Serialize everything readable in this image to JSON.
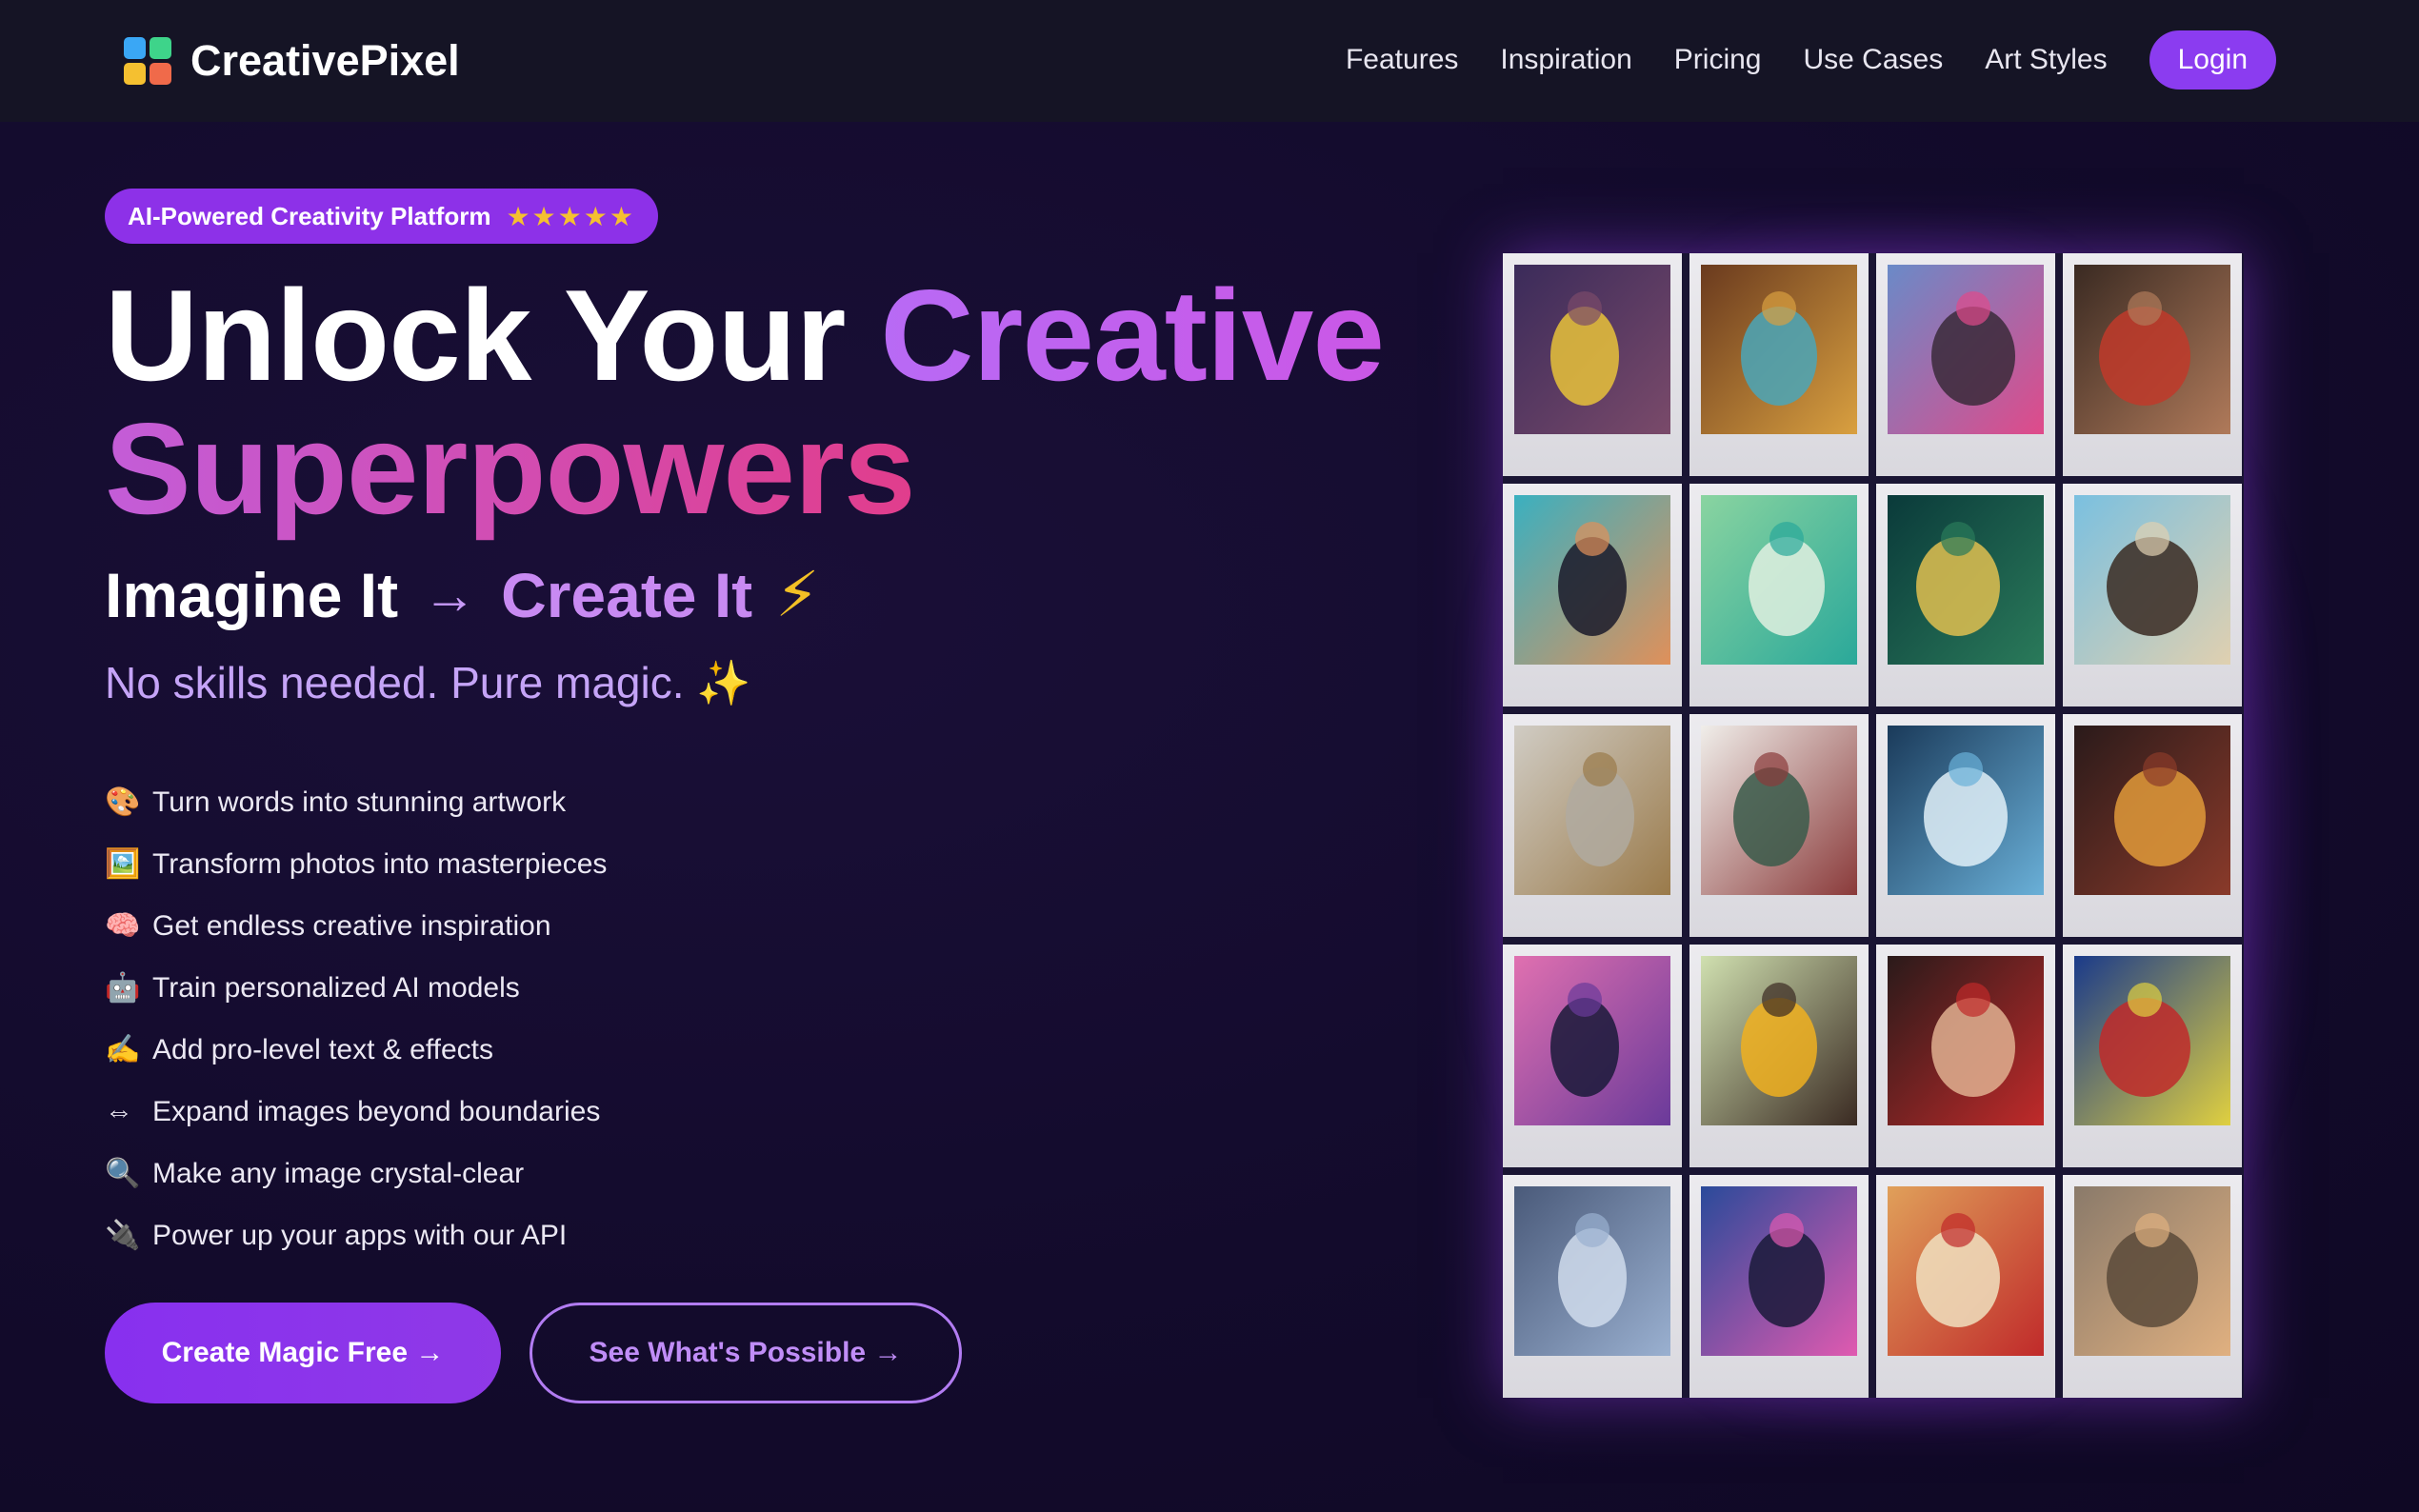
{
  "nav": {
    "brand": "CreativePixel",
    "logo_colors": [
      "#3aa7f5",
      "#3ed48a",
      "#f5c030",
      "#f06a4a"
    ],
    "links": [
      "Features",
      "Inspiration",
      "Pricing",
      "Use Cases",
      "Art Styles"
    ],
    "login": "Login"
  },
  "hero": {
    "badge": "AI-Powered Creativity Platform",
    "badge_stars": "★★★★★",
    "headline_1": "Unlock Your ",
    "headline_accent": "Creative",
    "headline_2": "Superpowers",
    "tagline_imagine": "Imagine It",
    "tagline_arrow": "→",
    "tagline_create": "Create It",
    "tagline_icon": "⚡",
    "subtag": "No skills needed. Pure magic. ✨",
    "features": [
      {
        "icon": "🎨",
        "icon_name": "palette-icon",
        "text": "Turn words into stunning artwork"
      },
      {
        "icon": "🖼️",
        "icon_name": "framed-picture-icon",
        "text": "Transform photos into masterpieces"
      },
      {
        "icon": "🧠",
        "icon_name": "brain-icon",
        "text": "Get endless creative inspiration"
      },
      {
        "icon": "🤖",
        "icon_name": "robot-icon",
        "text": "Train personalized AI models"
      },
      {
        "icon": "✍️",
        "icon_name": "writing-hand-icon",
        "text": "Add pro-level text & effects"
      },
      {
        "icon": "⇔",
        "icon_name": "expand-arrows-icon",
        "text": "Expand images beyond boundaries"
      },
      {
        "icon": "🔍",
        "icon_name": "magnifier-icon",
        "text": "Make any image crystal-clear"
      },
      {
        "icon": "🔌",
        "icon_name": "plug-icon",
        "text": "Power up your apps with our API"
      }
    ],
    "cta_primary": "Create Magic Free  →",
    "cta_secondary": "See What's Possible  →"
  },
  "colors": {
    "accent": "#8b3cf0",
    "background": "#130b2c",
    "nav_bg": "#151425"
  },
  "gallery": [
    {
      "name": "pikachu-room",
      "c1": "#3b2b5a",
      "c2": "#7a4a6a",
      "c3": "#e8c23a"
    },
    {
      "name": "split-face-portrait",
      "c1": "#6a3a1e",
      "c2": "#d9a040",
      "c3": "#4aa6b8"
    },
    {
      "name": "pink-hair-woman",
      "c1": "#6a8ac8",
      "c2": "#e04a8a",
      "c3": "#3a2a3a"
    },
    {
      "name": "renaissance-faces",
      "c1": "#3a2a22",
      "c2": "#b07a5a",
      "c3": "#c03a2a"
    },
    {
      "name": "pop-art-glasses",
      "c1": "#3ab0c0",
      "c2": "#e0905a",
      "c3": "#1a1a2a"
    },
    {
      "name": "teal-bottle",
      "c1": "#8ad4a0",
      "c2": "#2aa89a",
      "c3": "#e0f0e0"
    },
    {
      "name": "fantasy-tree-house",
      "c1": "#0a3a3a",
      "c2": "#2a7a5a",
      "c3": "#e0c050"
    },
    {
      "name": "beach-couple",
      "c1": "#7ac0e0",
      "c2": "#e0d0b0",
      "c3": "#3a2a22"
    },
    {
      "name": "gold-sculpture",
      "c1": "#d0ccc4",
      "c2": "#9a7a4a",
      "c3": "#b0aaa0"
    },
    {
      "name": "fashion-figures",
      "c1": "#f0eeea",
      "c2": "#8a3a3a",
      "c3": "#3a5a4a"
    },
    {
      "name": "glass-gallery",
      "c1": "#1a3a5a",
      "c2": "#6ab0d8",
      "c3": "#e0f0f8"
    },
    {
      "name": "plated-dish",
      "c1": "#2a1a1a",
      "c2": "#8a3a2a",
      "c3": "#e09a3a"
    },
    {
      "name": "ballet-dancer",
      "c1": "#e070b0",
      "c2": "#6a3a9a",
      "c3": "#1a1a3a"
    },
    {
      "name": "man-yellow-hoodie",
      "c1": "#d0e0b0",
      "c2": "#3a2a22",
      "c3": "#f0b020"
    },
    {
      "name": "painted-face-woman",
      "c1": "#2a1a1a",
      "c2": "#c02a2a",
      "c3": "#e0b090"
    },
    {
      "name": "abstract-mask",
      "c1": "#1a3a8a",
      "c2": "#e0d040",
      "c3": "#c02a2a"
    },
    {
      "name": "glass-city-model",
      "c1": "#4a5a7a",
      "c2": "#9ab0d0",
      "c3": "#d0dcec"
    },
    {
      "name": "runway-models",
      "c1": "#2a4a9a",
      "c2": "#e05ab0",
      "c3": "#1a1a3a"
    },
    {
      "name": "chef-dragon",
      "c1": "#e0a05a",
      "c2": "#c02a2a",
      "c3": "#f0e0c0"
    },
    {
      "name": "bear-hood-girl",
      "c1": "#8a7a6a",
      "c2": "#e0b080",
      "c3": "#5a4a3a"
    }
  ]
}
